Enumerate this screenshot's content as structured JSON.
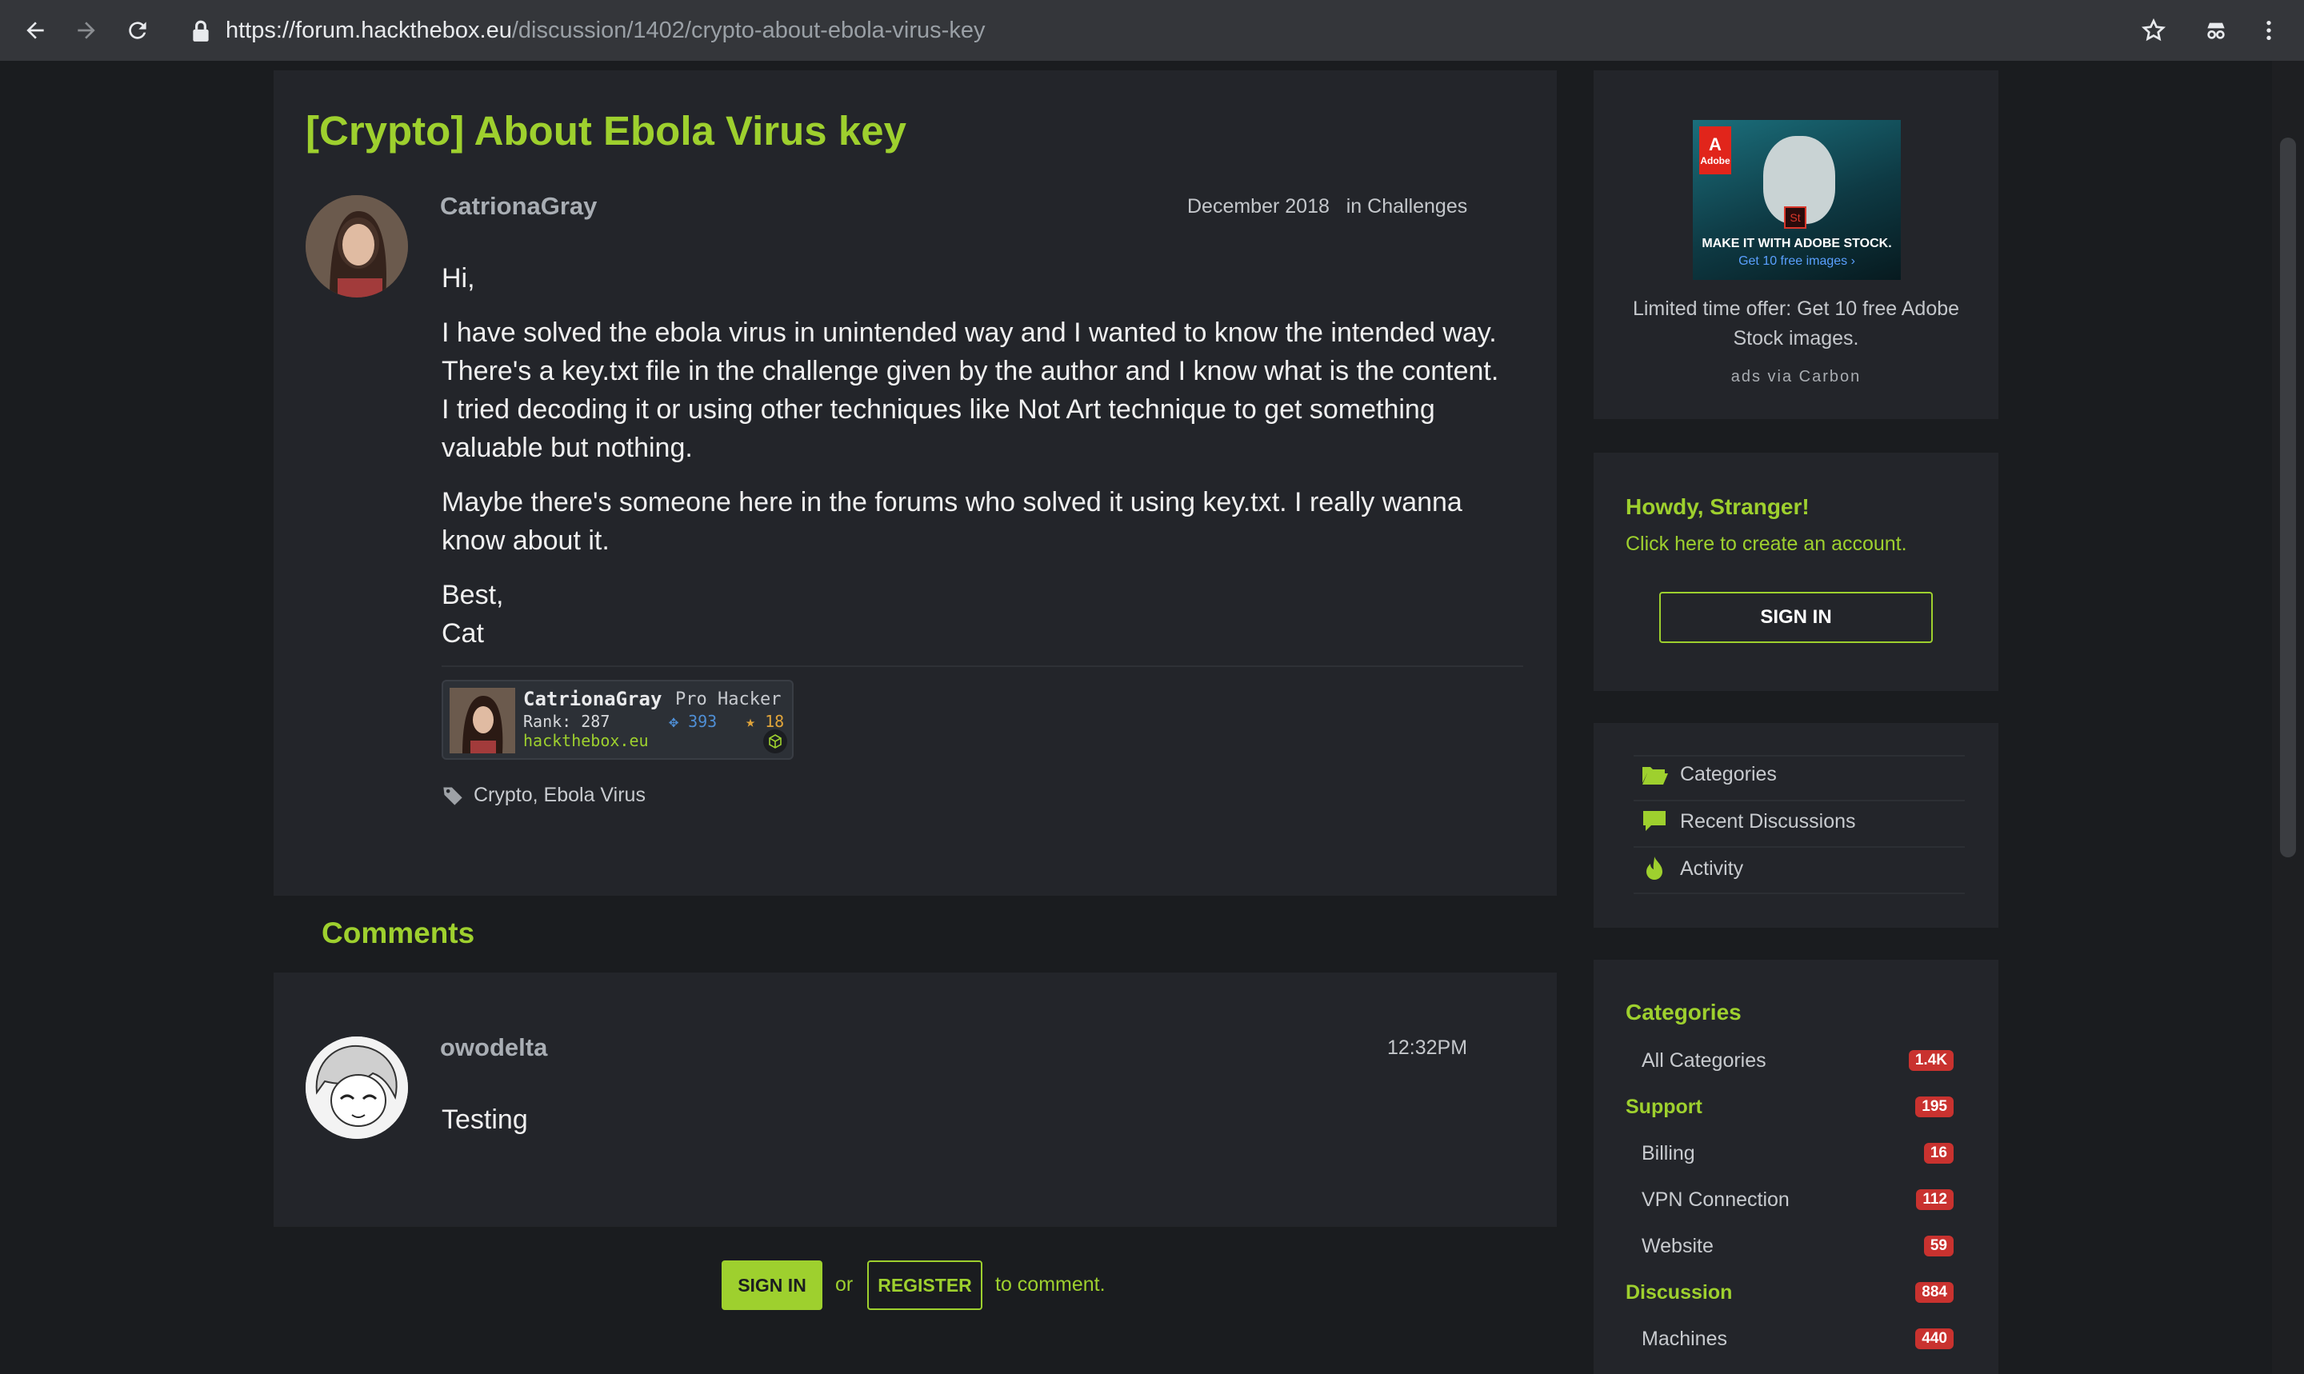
{
  "browser": {
    "url_host": "https://forum.hackthebox.eu",
    "url_path": "/discussion/1402/crypto-about-ebola-virus-key"
  },
  "thread": {
    "title": "[Crypto] About Ebola Virus key",
    "author": "CatrionaGray",
    "date": "December 2018",
    "category_prefix": "in",
    "category": "Challenges",
    "body": [
      "Hi,",
      "I have solved the ebola virus in unintended way and I wanted to know the intended way. There's a key.txt file in the challenge given by the author and I know what is the content. I tried decoding it or using other techniques like Not Art technique to get something valuable but nothing.",
      "Maybe there's someone here in the forums who solved it using key.txt. I really wanna know about it.",
      "Best,",
      "Cat"
    ],
    "signature": {
      "name": "CatrionaGray",
      "rank_title": "Pro Hacker",
      "rank": "Rank: 287",
      "respect": "393",
      "points": "18",
      "domain": "hackthebox.eu"
    },
    "tags": [
      "Crypto",
      "Ebola Virus"
    ]
  },
  "comments": {
    "heading": "Comments",
    "items": [
      {
        "author": "owodelta",
        "time": "12:32PM",
        "text": "Testing"
      }
    ]
  },
  "comment_actions": {
    "sign_in": "SIGN IN",
    "or": "or",
    "register": "REGISTER",
    "suffix": "to comment."
  },
  "ad": {
    "brand_mark": "Adobe",
    "product_mark": "St",
    "caption_line1": "MAKE IT WITH ADOBE STOCK.",
    "caption_line2": "Get 10 free images ›",
    "text": "Limited time offer: Get 10 free Adobe Stock images.",
    "via": "ads via Carbon"
  },
  "howdy": {
    "title": "Howdy, Stranger!",
    "link": "Click here to create an account.",
    "sign_in": "SIGN IN"
  },
  "nav": [
    {
      "label": "Categories",
      "icon": "folder-open-icon"
    },
    {
      "label": "Recent Discussions",
      "icon": "comment-icon"
    },
    {
      "label": "Activity",
      "icon": "flame-icon"
    }
  ],
  "categories": {
    "heading": "Categories",
    "rows": [
      {
        "name": "All Categories",
        "count": "1.4K",
        "group": false
      },
      {
        "name": "Support",
        "count": "195",
        "group": true
      },
      {
        "name": "Billing",
        "count": "16",
        "group": false
      },
      {
        "name": "VPN Connection",
        "count": "112",
        "group": false
      },
      {
        "name": "Website",
        "count": "59",
        "group": false
      },
      {
        "name": "Discussion",
        "count": "884",
        "group": true
      },
      {
        "name": "Machines",
        "count": "440",
        "group": false
      }
    ]
  },
  "colors": {
    "accent": "#9ed02e",
    "background": "#1a1c1f",
    "panel": "#23252a",
    "badge_red": "#c9322f"
  }
}
